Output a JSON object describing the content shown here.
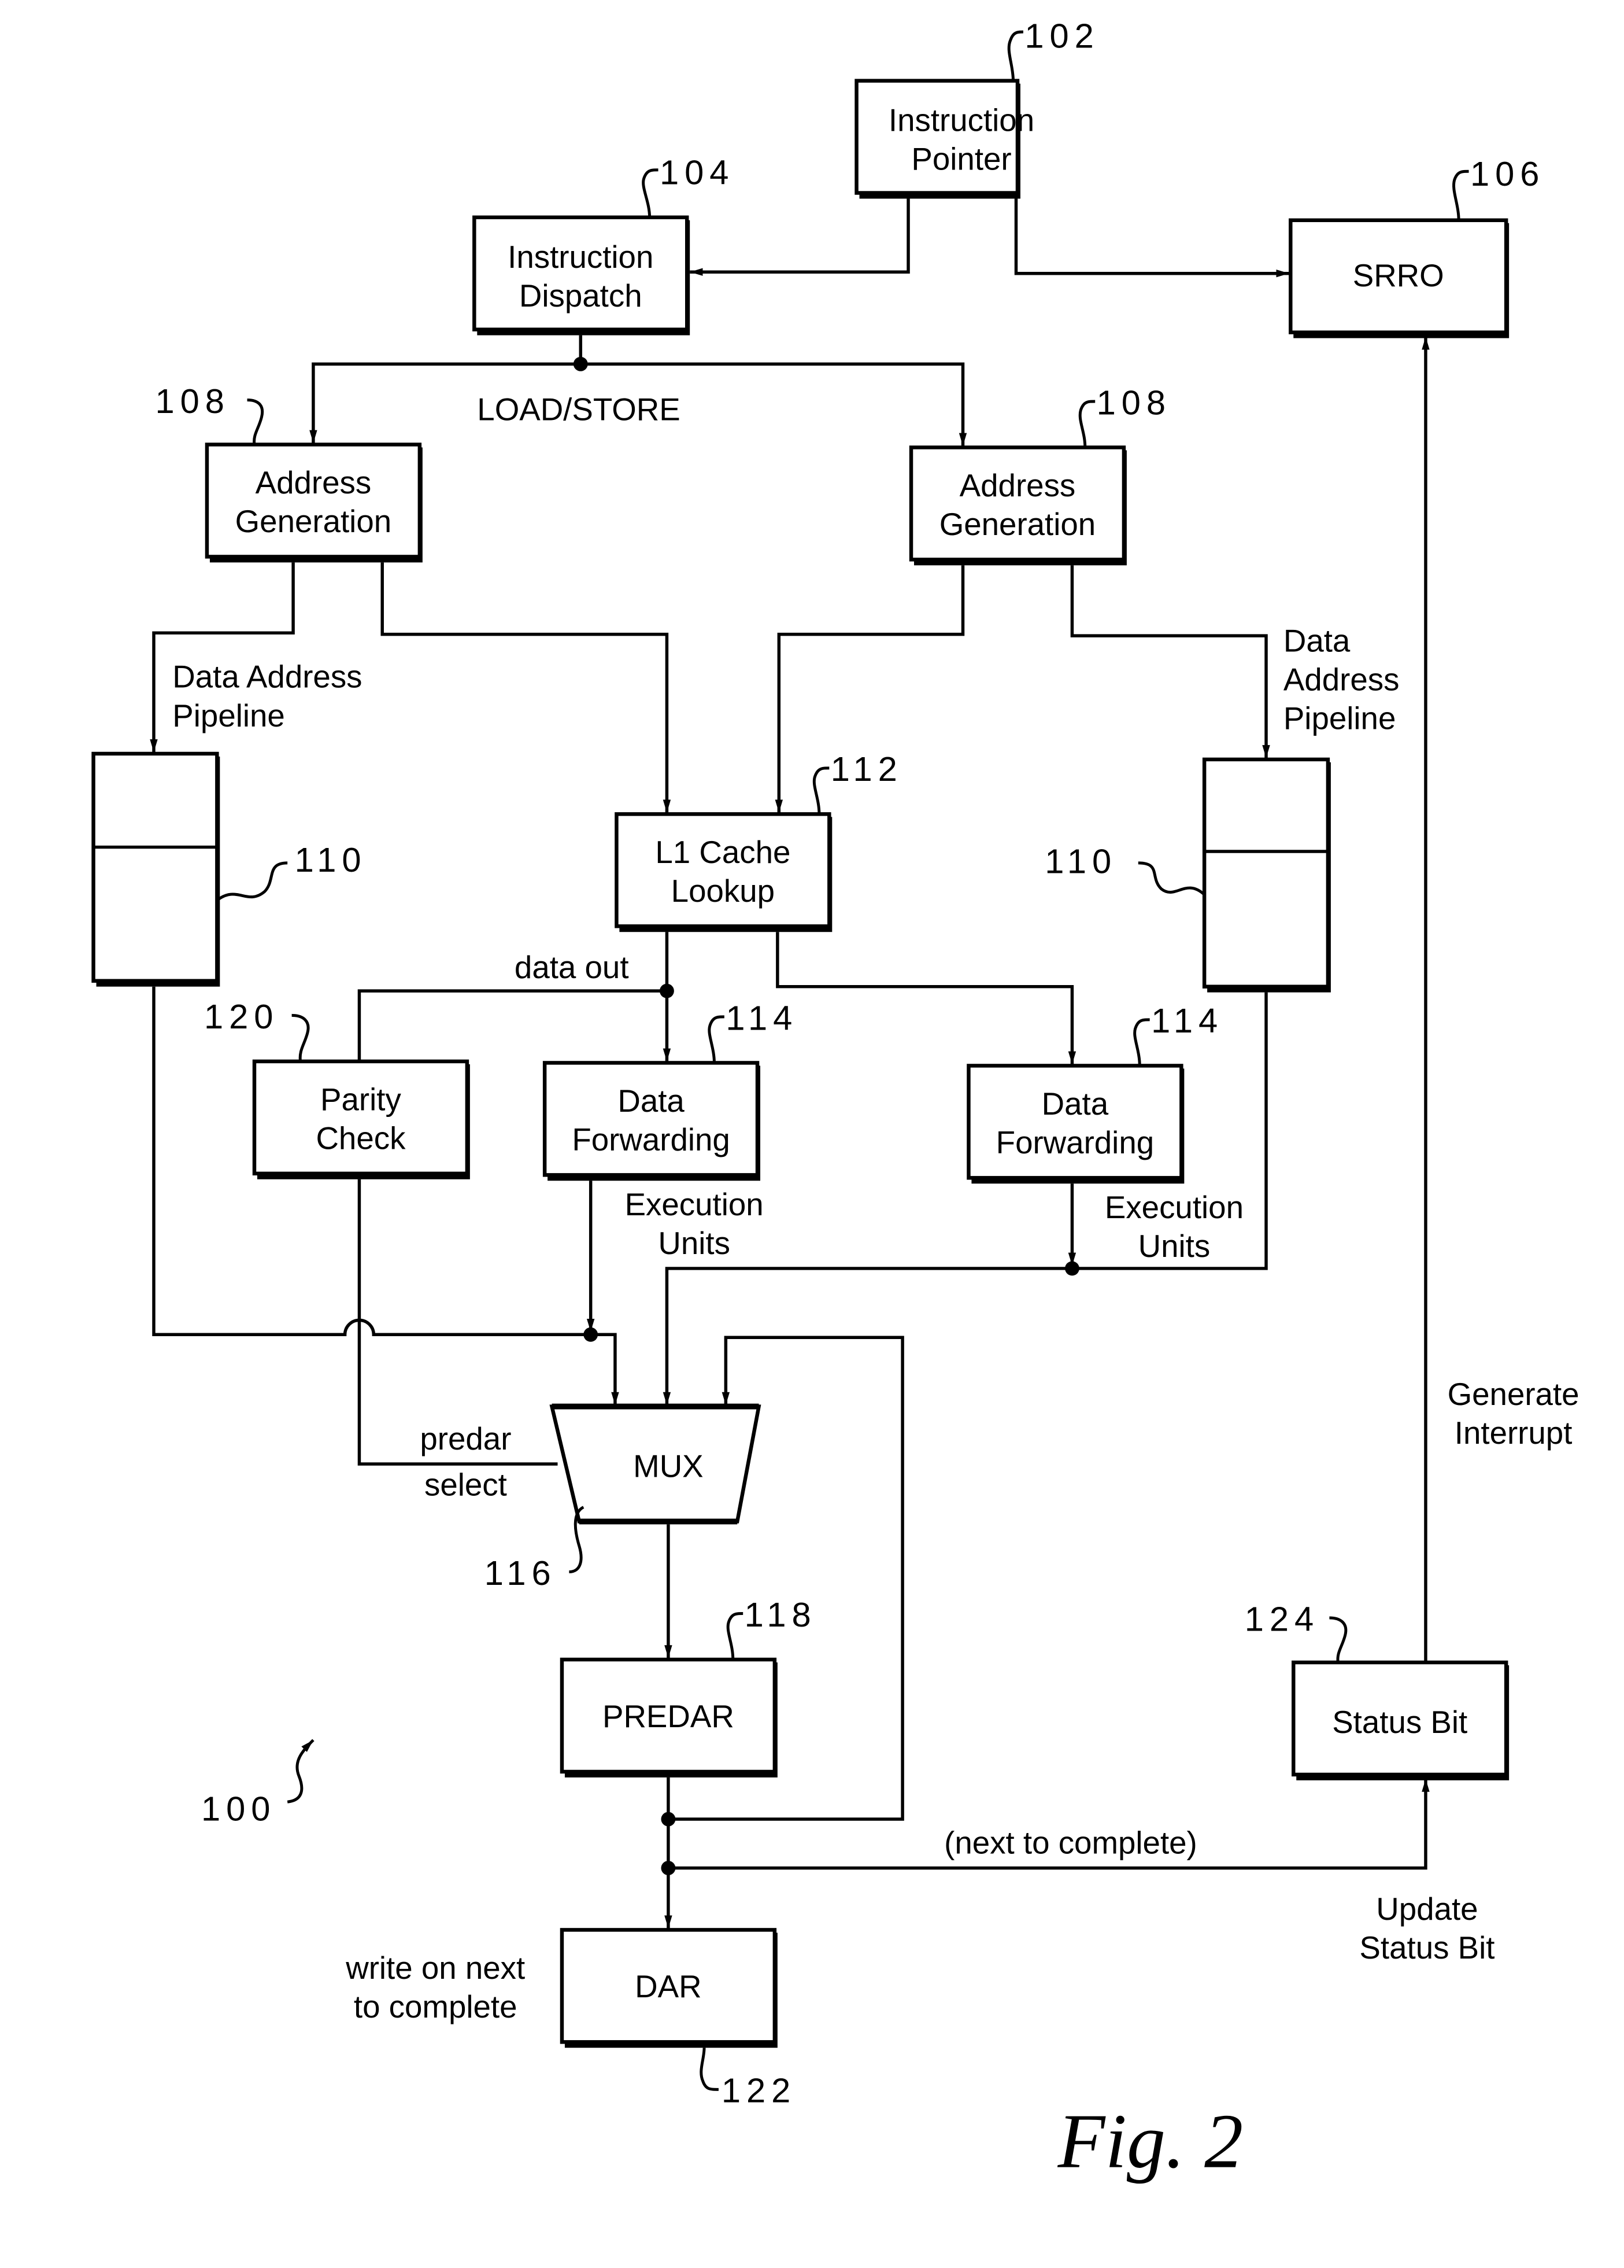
{
  "figure": {
    "title": "Fig. 2",
    "reference": "100"
  },
  "blocks": {
    "instruction_pointer": {
      "ref": "102",
      "line1": "Instruction",
      "line2": "Pointer"
    },
    "instruction_dispatch": {
      "ref": "104",
      "line1": "Instruction",
      "line2": "Dispatch"
    },
    "srro": {
      "ref": "106",
      "label": "SRRO"
    },
    "address_generation_left": {
      "ref": "108",
      "line1": "Address",
      "line2": "Generation"
    },
    "address_generation_right": {
      "ref": "108",
      "line1": "Address",
      "line2": "Generation"
    },
    "pipeline_left": {
      "ref": "110"
    },
    "pipeline_right": {
      "ref": "110"
    },
    "l1_cache": {
      "ref": "112",
      "line1": "L1 Cache",
      "line2": "Lookup"
    },
    "data_forwarding_left": {
      "ref": "114",
      "line1": "Data",
      "line2": "Forwarding"
    },
    "data_forwarding_right": {
      "ref": "114",
      "line1": "Data",
      "line2": "Forwarding"
    },
    "mux": {
      "ref": "116",
      "label": "MUX"
    },
    "predar": {
      "ref": "118",
      "label": "PREDAR"
    },
    "parity_check": {
      "ref": "120",
      "line1": "Parity",
      "line2": "Check"
    },
    "dar": {
      "ref": "122",
      "label": "DAR"
    },
    "status_bit": {
      "ref": "124",
      "label": "Status Bit"
    }
  },
  "labels": {
    "load_store": "LOAD/STORE",
    "data_address_pipeline_left": {
      "line1": "Data Address",
      "line2": "Pipeline"
    },
    "data_address_pipeline_right": {
      "line1": "Data",
      "line2": "Address",
      "line3": "Pipeline"
    },
    "data_out": "data out",
    "execution_units_left": {
      "line1": "Execution",
      "line2": "Units"
    },
    "execution_units_right": {
      "line1": "Execution",
      "line2": "Units"
    },
    "predar_select": {
      "line1": "predar",
      "line2": "select"
    },
    "generate_interrupt": {
      "line1": "Generate",
      "line2": "Interrupt"
    },
    "next_to_complete": "(next to complete)",
    "update_status_bit": {
      "line1": "Update",
      "line2": "Status Bit"
    },
    "write_on_next": {
      "line1": "write on next",
      "line2": "to complete"
    }
  }
}
